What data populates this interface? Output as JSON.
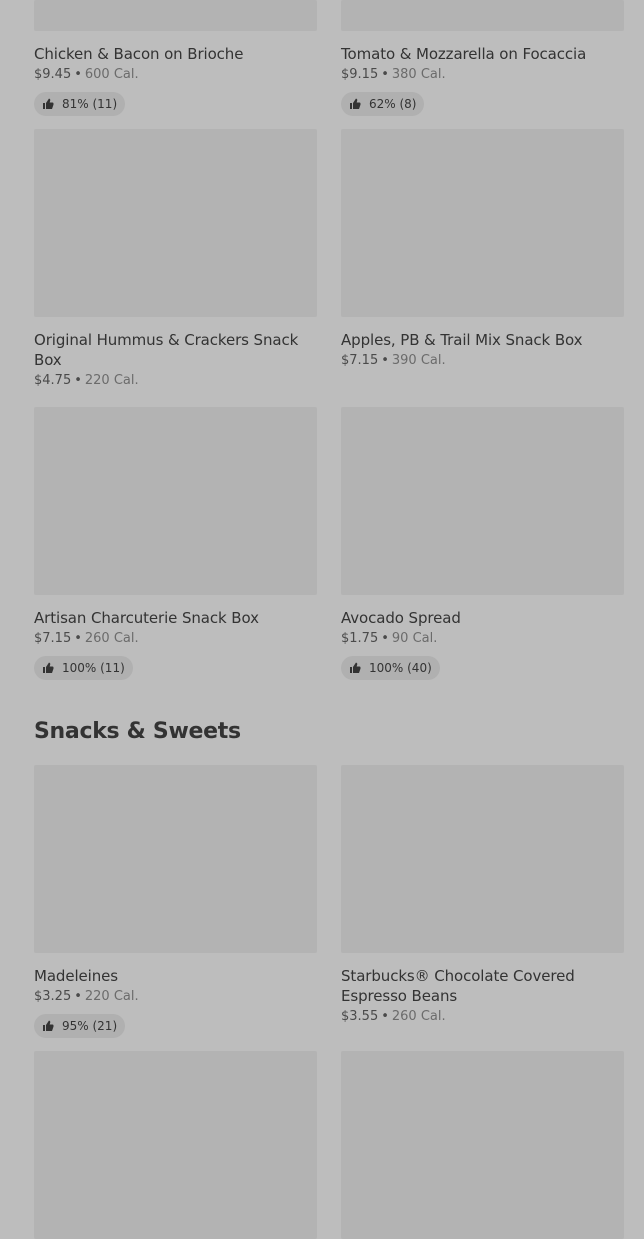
{
  "row1": [
    {
      "name": "Chicken & Bacon on Brioche",
      "price": "$9.45",
      "calories": "600 Cal.",
      "rating": "81% (11)"
    },
    {
      "name": "Tomato & Mozzarella on Focaccia",
      "price": "$9.15",
      "calories": "380 Cal.",
      "rating": "62% (8)"
    }
  ],
  "row2": [
    {
      "name": "Original Hummus & Crackers Snack Box",
      "price": "$4.75",
      "calories": "220 Cal."
    },
    {
      "name": "Apples, PB & Trail Mix Snack Box",
      "price": "$7.15",
      "calories": "390 Cal."
    }
  ],
  "row3": [
    {
      "name": "Artisan Charcuterie Snack Box",
      "price": "$7.15",
      "calories": "260 Cal.",
      "rating": "100% (11)"
    },
    {
      "name": "Avocado Spread",
      "price": "$1.75",
      "calories": "90 Cal.",
      "rating": "100% (40)"
    }
  ],
  "section": {
    "title": "Snacks & Sweets"
  },
  "row4": [
    {
      "name": "Madeleines",
      "price": "$3.25",
      "calories": "220 Cal.",
      "rating": "95% (21)"
    },
    {
      "name": "Starbucks® Chocolate Covered Espresso Beans",
      "price": "$3.55",
      "calories": "260 Cal."
    }
  ],
  "separator": "•",
  "icons": {
    "rating": "thumbs-up-icon"
  }
}
